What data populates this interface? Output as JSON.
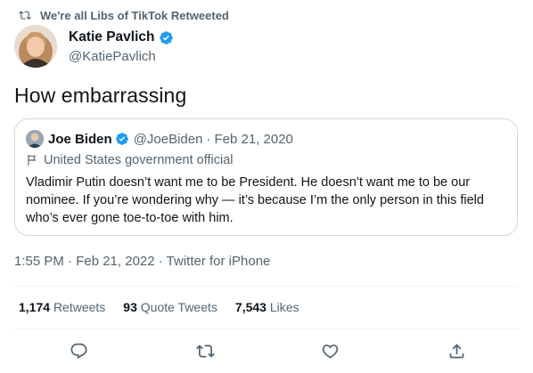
{
  "retweet_header": {
    "text": "We're all Libs of TikTok Retweeted",
    "icon": "retweet-icon"
  },
  "author": {
    "name": "Katie Pavlich",
    "handle": "@KatiePavlich",
    "verified": true
  },
  "tweet": {
    "text": "How embarrassing"
  },
  "quoted_tweet": {
    "name": "Joe Biden",
    "handle": "@JoeBiden",
    "separator": "·",
    "date": "Feb 21, 2020",
    "label": "United States government official",
    "body": "Vladimir Putin doesn’t want me to be President. He doesn’t want me to be our nominee. If you’re wondering why — it’s because I’m the only person in this field who’s ever gone toe-to-toe with him."
  },
  "timestamp": "1:55 PM · Feb 21, 2022 · Twitter for iPhone",
  "stats": {
    "retweets_count": "1,174",
    "retweets_label": "Retweets",
    "quotes_count": "93",
    "quotes_label": "Quote Tweets",
    "likes_count": "7,543",
    "likes_label": "Likes"
  },
  "actions": [
    "reply-icon",
    "retweet-icon",
    "like-icon",
    "share-icon"
  ],
  "colors": {
    "text": "#0f1419",
    "muted": "#536471",
    "verified": "#1d9bf0",
    "border": "#cfd9de"
  }
}
